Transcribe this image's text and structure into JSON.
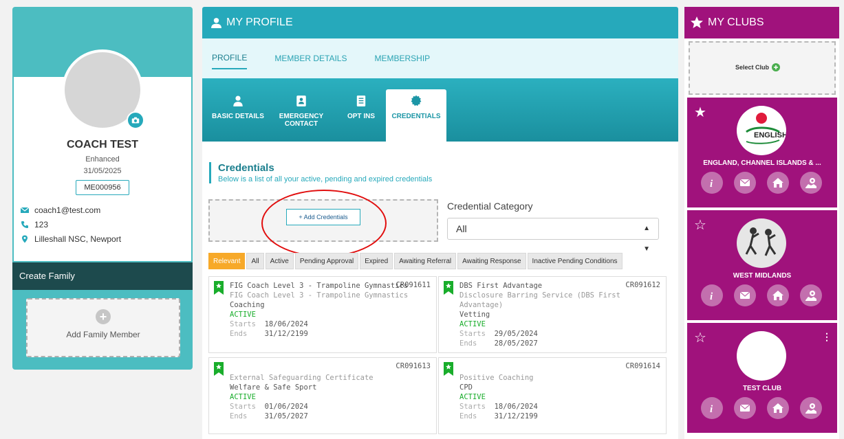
{
  "profile": {
    "name": "COACH TEST",
    "level": "Enhanced",
    "date": "31/05/2025",
    "member_id": "ME000956",
    "email": "coach1@test.com",
    "phone": "123",
    "location": "Lilleshall NSC, Newport"
  },
  "family": {
    "header": "Create Family",
    "add_label": "Add Family Member"
  },
  "center": {
    "title": "MY PROFILE",
    "top_tabs": [
      "PROFILE",
      "MEMBER DETAILS",
      "MEMBERSHIP"
    ],
    "sub_tabs": {
      "basic": "BASIC DETAILS",
      "emergency_line1": "EMERGENCY",
      "emergency_line2": "CONTACT",
      "optins": "OPT INS",
      "credentials": "CREDENTIALS"
    },
    "cred_title": "Credentials",
    "cred_sub": "Below is a list of all your active, pending and expired credentials",
    "add_btn": "+ Add Credentials",
    "category_label": "Credential Category",
    "category_value": "All",
    "filters": [
      "Relevant",
      "All",
      "Active",
      "Pending Approval",
      "Expired",
      "Awaiting Referral",
      "Awaiting Response",
      "Inactive Pending Conditions"
    ]
  },
  "credentials": [
    {
      "title": "FIG Coach Level 3 - Trampoline Gymnastics",
      "code": "CR091611",
      "desc": "FIG Coach Level 3 - Trampoline Gymnastics",
      "type": "Coaching",
      "status": "ACTIVE",
      "starts": "18/06/2024",
      "ends": "31/12/2199"
    },
    {
      "title": "DBS First Advantage",
      "code": "CR091612",
      "desc": "Disclosure Barring Service (DBS First Advantage)",
      "type": "Vetting",
      "status": "ACTIVE",
      "starts": "29/05/2024",
      "ends": "28/05/2027"
    },
    {
      "title": "External Safeguarding Certificate",
      "code": "CR091613",
      "desc": "Welfare & Safe Sport",
      "status": "ACTIVE",
      "starts": "01/06/2024",
      "ends": "31/05/2027"
    },
    {
      "title": "Positive Coaching",
      "code": "CR091614",
      "desc": "CPD",
      "status": "ACTIVE",
      "starts": "18/06/2024",
      "ends": "31/12/2199"
    }
  ],
  "labels": {
    "starts": "Starts",
    "ends": "Ends"
  },
  "clubs": {
    "title": "MY CLUBS",
    "select_label": "Select Club",
    "items": [
      {
        "name": "ENGLAND, CHANNEL ISLANDS & ...",
        "logo_text": "ENGLISH",
        "favorite": true
      },
      {
        "name": "WEST MIDLANDS",
        "favorite": false
      },
      {
        "name": "TEST CLUB",
        "favorite": false
      }
    ]
  },
  "colors": {
    "teal": "#26a9bb",
    "dark_teal": "#1d4a4d",
    "purple": "#a0127c",
    "orange": "#f7a929",
    "green": "#19ad2b",
    "red": "#e10d0d"
  }
}
